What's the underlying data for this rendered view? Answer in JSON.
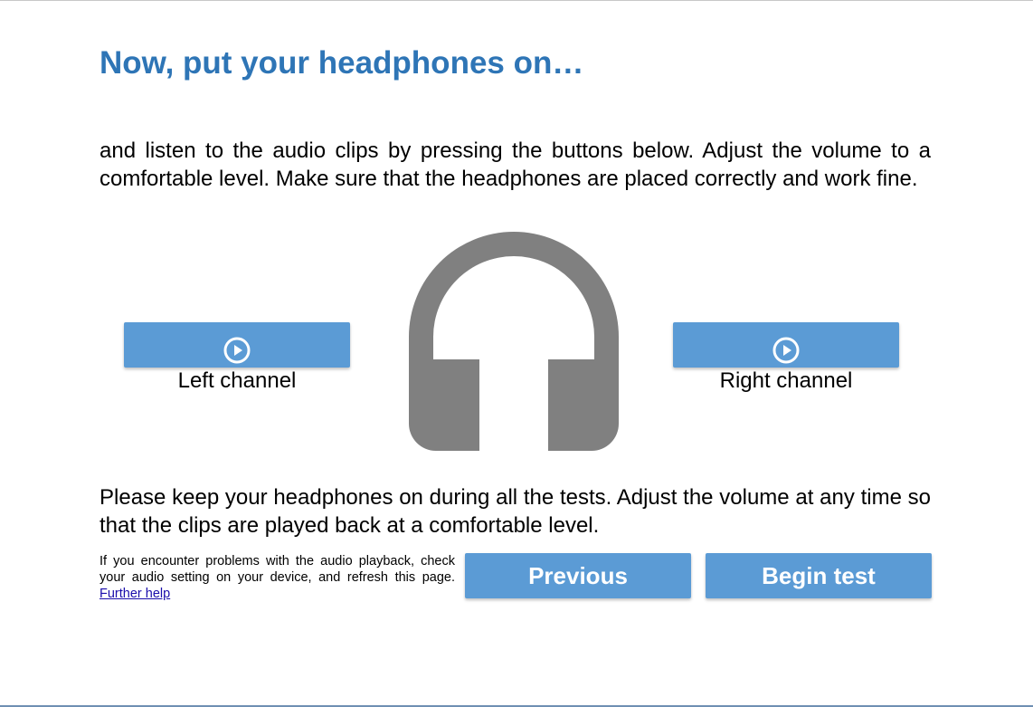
{
  "header": {
    "title": "Now, put your headphones on…"
  },
  "intro": {
    "text": "and listen to the audio clips by pressing the buttons below. Adjust the volume to a comfortable level. Make sure that the headphones are placed correctly and work fine."
  },
  "channels": {
    "left": {
      "label": "Left channel",
      "icon": "play-circle-icon"
    },
    "right": {
      "label": "Right channel",
      "icon": "play-circle-icon"
    },
    "illustration_icon": "headphones-icon"
  },
  "instructions": {
    "text": "Please keep your headphones on during all the tests. Adjust the volume at any time so that the clips are played back at a comfortable level."
  },
  "help": {
    "text": "If you encounter problems with the audio playback, check your audio setting on your device, and refresh this page. ",
    "link_label": "Further help"
  },
  "navigation": {
    "previous_label": "Previous",
    "begin_label": "Begin test"
  },
  "colors": {
    "accent": "#5b9bd5",
    "title": "#2e75b6",
    "illustration": "#808080",
    "link": "#1a0dab"
  }
}
